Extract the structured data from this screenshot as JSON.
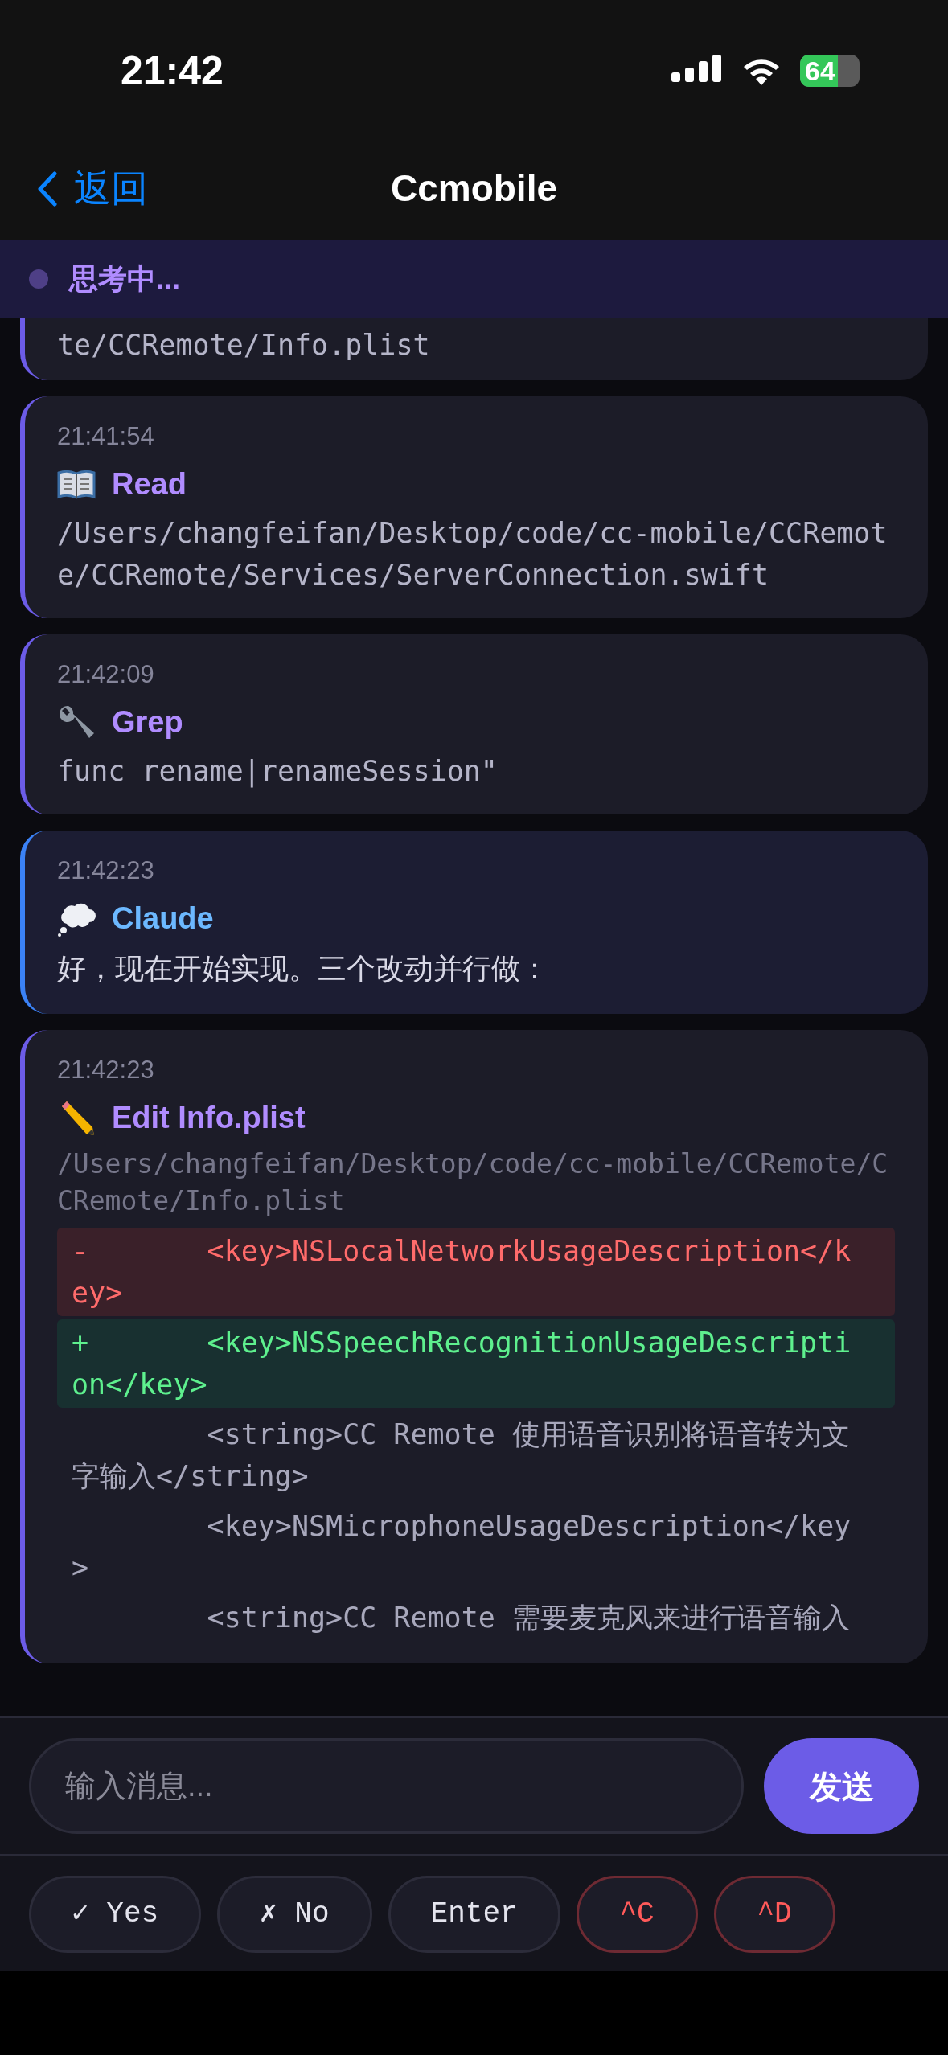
{
  "status_bar": {
    "time": "21:42",
    "battery": "64"
  },
  "nav": {
    "back": "返回",
    "title": "Ccmobile"
  },
  "banner": {
    "text": "思考中..."
  },
  "messages": [
    {
      "kind": "partial",
      "body": "te/CCRemote/Info.plist"
    },
    {
      "kind": "read",
      "time": "21:41:54",
      "title": "Read",
      "body": "/Users/changfeifan/Desktop/code/cc-mobile/CCRemote/CCRemote/Services/ServerConnection.swift"
    },
    {
      "kind": "grep",
      "time": "21:42:09",
      "title": "Grep",
      "body": "func rename|renameSession\""
    },
    {
      "kind": "claude",
      "time": "21:42:23",
      "title": "Claude",
      "body": "好，现在开始实现。三个改动并行做："
    },
    {
      "kind": "edit",
      "time": "21:42:23",
      "title": "Edit Info.plist",
      "path": "/Users/changfeifan/Desktop/code/cc-mobile/CCRemote/CCRemote/Info.plist",
      "diff": [
        {
          "kind": "removed",
          "text": "-       <key>NSLocalNetworkUsageDescription</key>"
        },
        {
          "kind": "added",
          "text": "+       <key>NSSpeechRecognitionUsageDescription</key>"
        },
        {
          "kind": "context",
          "text": "        <string>CC Remote 使用语音识别将语音转为文字输入</string>"
        },
        {
          "kind": "context",
          "text": "        <key>NSMicrophoneUsageDescription</key>"
        },
        {
          "kind": "context",
          "text": "        <string>CC Remote 需要麦克风来进行语音输入"
        }
      ]
    }
  ],
  "composer": {
    "placeholder": "输入消息...",
    "send": "发送"
  },
  "quick_keys": [
    {
      "label": "✓ Yes",
      "kind": "normal"
    },
    {
      "label": "✗ No",
      "kind": "normal"
    },
    {
      "label": "Enter",
      "kind": "normal"
    },
    {
      "label": "^C",
      "kind": "danger"
    },
    {
      "label": "^D",
      "kind": "danger"
    }
  ]
}
